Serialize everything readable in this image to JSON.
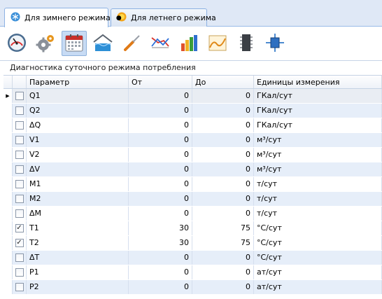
{
  "tabs": [
    {
      "label": "Для зимнего режима",
      "icon": "snowflake-icon",
      "active": true,
      "marker": "●"
    },
    {
      "label": "Для летнего режима",
      "icon": "sun-icon",
      "active": false
    }
  ],
  "toolbar": {
    "buttons": [
      {
        "name": "gauge-icon",
        "selected": false
      },
      {
        "name": "gears-icon",
        "selected": false
      },
      {
        "name": "calendar-icon",
        "selected": true
      },
      {
        "name": "water-tank-icon",
        "selected": false
      },
      {
        "name": "screwdriver-icon",
        "selected": false
      },
      {
        "name": "crossing-lines-chart-icon",
        "selected": false
      },
      {
        "name": "bar-chart-icon",
        "selected": false
      },
      {
        "name": "area-chart-icon",
        "selected": false
      },
      {
        "name": "chip-icon",
        "selected": false
      },
      {
        "name": "component-icon",
        "selected": false
      }
    ]
  },
  "panel": {
    "title": "Диагностика суточного режима потребления"
  },
  "grid": {
    "columns": [
      "Параметр",
      "От",
      "До",
      "Единицы измерения"
    ],
    "rows": [
      {
        "param": "Q1",
        "from": "0",
        "to": "0",
        "unit": "ГКал/сут",
        "checked": false,
        "current": true
      },
      {
        "param": "Q2",
        "from": "0",
        "to": "0",
        "unit": "ГКал/сут",
        "checked": false
      },
      {
        "param": "ΔQ",
        "from": "0",
        "to": "0",
        "unit": "ГКал/сут",
        "checked": false
      },
      {
        "param": "V1",
        "from": "0",
        "to": "0",
        "unit": "м³/сут",
        "checked": false
      },
      {
        "param": "V2",
        "from": "0",
        "to": "0",
        "unit": "м³/сут",
        "checked": false
      },
      {
        "param": "ΔV",
        "from": "0",
        "to": "0",
        "unit": "м³/сут",
        "checked": false
      },
      {
        "param": "M1",
        "from": "0",
        "to": "0",
        "unit": "т/сут",
        "checked": false
      },
      {
        "param": "M2",
        "from": "0",
        "to": "0",
        "unit": "т/сут",
        "checked": false
      },
      {
        "param": "ΔM",
        "from": "0",
        "to": "0",
        "unit": "т/сут",
        "checked": false
      },
      {
        "param": "T1",
        "from": "30",
        "to": "75",
        "unit": "°С/сут",
        "checked": true
      },
      {
        "param": "T2",
        "from": "30",
        "to": "75",
        "unit": "°С/сут",
        "checked": true
      },
      {
        "param": "ΔT",
        "from": "0",
        "to": "0",
        "unit": "°С/сут",
        "checked": false
      },
      {
        "param": "P1",
        "from": "0",
        "to": "0",
        "unit": "ат/сут",
        "checked": false
      },
      {
        "param": "P2",
        "from": "0",
        "to": "0",
        "unit": "ат/сут",
        "checked": false
      }
    ]
  },
  "colors": {
    "accent": "#99bbe8",
    "row_alt": "#e6eef9",
    "selection": "#c7dbf4"
  }
}
